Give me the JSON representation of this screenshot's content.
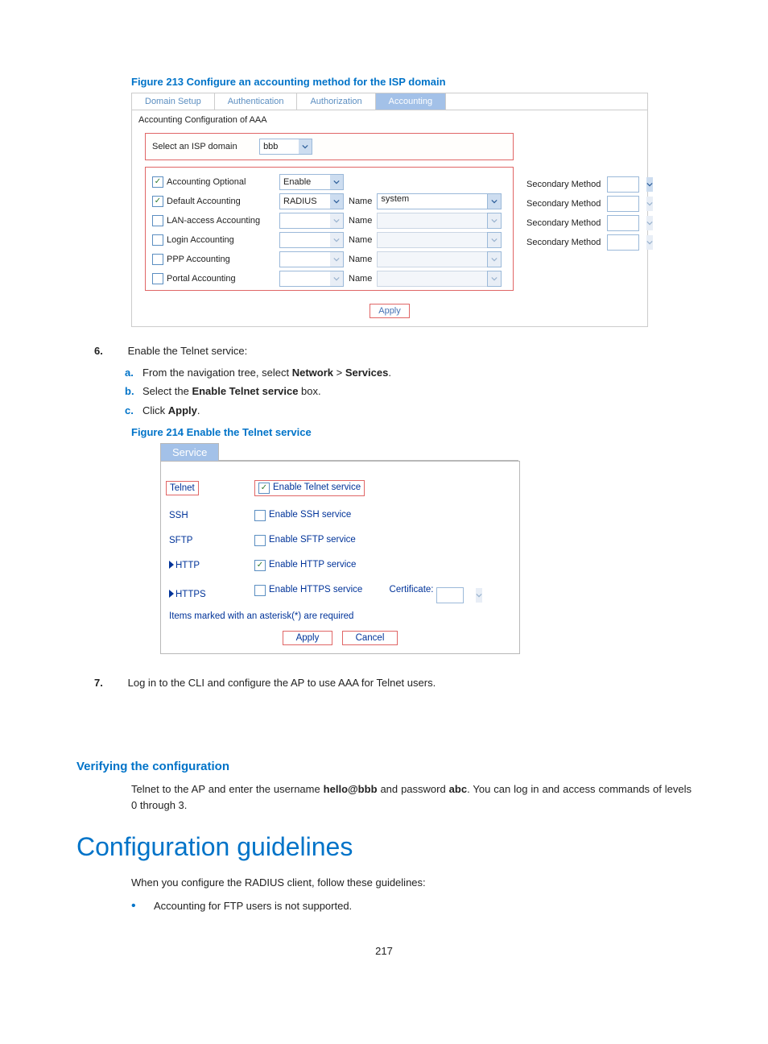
{
  "figure213": {
    "caption": "Figure 213 Configure an accounting method for the ISP domain",
    "tabs": [
      "Domain Setup",
      "Authentication",
      "Authorization",
      "Accounting"
    ],
    "active_tab_index": 3,
    "section": "Accounting Configuration of AAA",
    "select_label": "Select an ISP domain",
    "select_value": "bbb",
    "rows": [
      {
        "checked": true,
        "label": "Accounting Optional",
        "dd1": "Enable",
        "dd1_active": true,
        "has_name": false
      },
      {
        "checked": true,
        "label": "Default Accounting",
        "dd1": "RADIUS",
        "dd1_active": true,
        "has_name": true,
        "name_value": "system",
        "name_active": true,
        "sec_label": "Secondary Method",
        "sec_active": true
      },
      {
        "checked": false,
        "label": "LAN-access Accounting",
        "dd1": "",
        "dd1_active": false,
        "has_name": true,
        "name_value": "",
        "name_active": false,
        "sec_label": "Secondary Method",
        "sec_active": false
      },
      {
        "checked": false,
        "label": "Login Accounting",
        "dd1": "",
        "dd1_active": false,
        "has_name": true,
        "name_value": "",
        "name_active": false,
        "sec_label": "Secondary Method",
        "sec_active": false
      },
      {
        "checked": false,
        "label": "PPP Accounting",
        "dd1": "",
        "dd1_active": false,
        "has_name": true,
        "name_value": "",
        "name_active": false,
        "sec_label": "Secondary Method",
        "sec_active": false
      },
      {
        "checked": false,
        "label": "Portal Accounting",
        "dd1": "",
        "dd1_active": false,
        "has_name": true,
        "name_value": "",
        "name_active": false
      }
    ],
    "name_label": "Name",
    "apply_label": "Apply"
  },
  "step6": {
    "num": "6.",
    "text": "Enable the Telnet service:",
    "subs": [
      {
        "n": "a.",
        "prefix": "From the navigation tree, select ",
        "b1": "Network",
        "mid": " > ",
        "b2": "Services",
        "suffix": "."
      },
      {
        "n": "b.",
        "prefix": "Select the ",
        "b1": "Enable Telnet service",
        "suffix": " box."
      },
      {
        "n": "c.",
        "prefix": "Click ",
        "b1": "Apply",
        "suffix": "."
      }
    ]
  },
  "figure214": {
    "caption": "Figure 214 Enable the Telnet service",
    "tab": "Service",
    "rows": [
      {
        "name": "Telnet",
        "label": "Enable Telnet service",
        "checked": true,
        "expand": false,
        "highlight": true
      },
      {
        "name": "SSH",
        "label": "Enable SSH service",
        "checked": false,
        "expand": false
      },
      {
        "name": "SFTP",
        "label": "Enable SFTP service",
        "checked": false,
        "expand": false
      },
      {
        "name": "HTTP",
        "label": "Enable HTTP service",
        "checked": true,
        "expand": true
      },
      {
        "name": "HTTPS",
        "label": "Enable HTTPS service",
        "checked": false,
        "expand": true,
        "cert_label": "Certificate:"
      }
    ],
    "note": "Items marked with an asterisk(*) are required",
    "apply": "Apply",
    "cancel": "Cancel"
  },
  "step7": {
    "num": "7.",
    "text": "Log in to the CLI and configure the AP to use AAA for Telnet users."
  },
  "verify": {
    "heading": "Verifying the configuration",
    "p1a": "Telnet to the AP and enter the username ",
    "p1b": "hello@bbb",
    "p1c": " and password ",
    "p1d": "abc",
    "p1e": ". You can log in and access commands of levels 0 through 3."
  },
  "guidelines": {
    "heading": "Configuration guidelines",
    "intro": "When you configure the RADIUS client, follow these guidelines:",
    "bullets": [
      "Accounting for FTP users is not supported."
    ]
  },
  "page_number": "217"
}
